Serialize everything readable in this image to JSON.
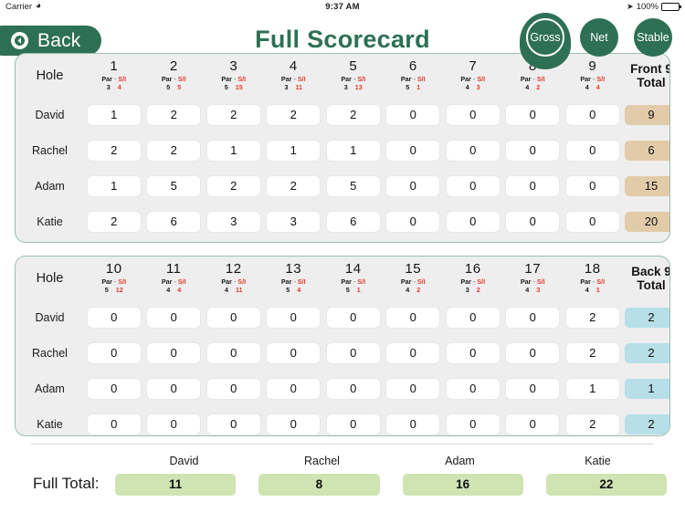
{
  "status_bar": {
    "carrier": "Carrier",
    "wifi_icon": "wifi-icon",
    "time": "9:37 AM",
    "location_icon": "location-arrow-icon",
    "battery_percent": "100%",
    "battery_icon": "battery-full-icon"
  },
  "nav": {
    "back_label": "Back",
    "back_icon": "back-chevron-icon",
    "title": "Full Scorecard",
    "modes": [
      {
        "label": "Gross",
        "selected": true
      },
      {
        "label": "Net",
        "selected": false
      },
      {
        "label": "Stable",
        "selected": false
      }
    ]
  },
  "colors": {
    "brand_green": "#2e7055",
    "front_total_bg": "#e2cba9",
    "back_total_bg": "#b6dfe8",
    "full_total_bg": "#cfe4b2",
    "si_red": "#e23b2e",
    "card_bg": "#eeeeee"
  },
  "labels": {
    "hole": "Hole",
    "par": "Par",
    "si": "S/I",
    "separator": "-",
    "front_total": "Front 9\nTotal",
    "front_total_line1": "Front 9",
    "front_total_line2": "Total",
    "back_total_line1": "Back 9",
    "back_total_line2": "Total",
    "full_total": "Full Total:"
  },
  "players": [
    "David",
    "Rachel",
    "Adam",
    "Katie"
  ],
  "front_nine": {
    "holes": [
      {
        "number": "1",
        "par": "3",
        "si": "4"
      },
      {
        "number": "2",
        "par": "5",
        "si": "5"
      },
      {
        "number": "3",
        "par": "5",
        "si": "15"
      },
      {
        "number": "4",
        "par": "3",
        "si": "11"
      },
      {
        "number": "5",
        "par": "3",
        "si": "13"
      },
      {
        "number": "6",
        "par": "5",
        "si": "1"
      },
      {
        "number": "7",
        "par": "4",
        "si": "3"
      },
      {
        "number": "8",
        "par": "4",
        "si": "2"
      },
      {
        "number": "9",
        "par": "4",
        "si": "4"
      }
    ],
    "rows": [
      {
        "player": "David",
        "scores": [
          "1",
          "2",
          "2",
          "2",
          "2",
          "0",
          "0",
          "0",
          "0"
        ],
        "total": "9"
      },
      {
        "player": "Rachel",
        "scores": [
          "2",
          "2",
          "1",
          "1",
          "1",
          "0",
          "0",
          "0",
          "0"
        ],
        "total": "6"
      },
      {
        "player": "Adam",
        "scores": [
          "1",
          "5",
          "2",
          "2",
          "5",
          "0",
          "0",
          "0",
          "0"
        ],
        "total": "15"
      },
      {
        "player": "Katie",
        "scores": [
          "2",
          "6",
          "3",
          "3",
          "6",
          "0",
          "0",
          "0",
          "0"
        ],
        "total": "20"
      }
    ]
  },
  "back_nine": {
    "holes": [
      {
        "number": "10",
        "par": "5",
        "si": "12"
      },
      {
        "number": "11",
        "par": "4",
        "si": "4"
      },
      {
        "number": "12",
        "par": "4",
        "si": "11"
      },
      {
        "number": "13",
        "par": "5",
        "si": "4"
      },
      {
        "number": "14",
        "par": "5",
        "si": "1"
      },
      {
        "number": "15",
        "par": "4",
        "si": "2"
      },
      {
        "number": "16",
        "par": "3",
        "si": "2"
      },
      {
        "number": "17",
        "par": "4",
        "si": "3"
      },
      {
        "number": "18",
        "par": "4",
        "si": "1"
      }
    ],
    "rows": [
      {
        "player": "David",
        "scores": [
          "0",
          "0",
          "0",
          "0",
          "0",
          "0",
          "0",
          "0",
          "2"
        ],
        "total": "2"
      },
      {
        "player": "Rachel",
        "scores": [
          "0",
          "0",
          "0",
          "0",
          "0",
          "0",
          "0",
          "0",
          "2"
        ],
        "total": "2"
      },
      {
        "player": "Adam",
        "scores": [
          "0",
          "0",
          "0",
          "0",
          "0",
          "0",
          "0",
          "0",
          "1"
        ],
        "total": "1"
      },
      {
        "player": "Katie",
        "scores": [
          "0",
          "0",
          "0",
          "0",
          "0",
          "0",
          "0",
          "0",
          "2"
        ],
        "total": "2"
      }
    ]
  },
  "footer": {
    "label": "Full Total:",
    "totals": [
      {
        "player": "David",
        "value": "11"
      },
      {
        "player": "Rachel",
        "value": "8"
      },
      {
        "player": "Adam",
        "value": "16"
      },
      {
        "player": "Katie",
        "value": "22"
      }
    ]
  }
}
